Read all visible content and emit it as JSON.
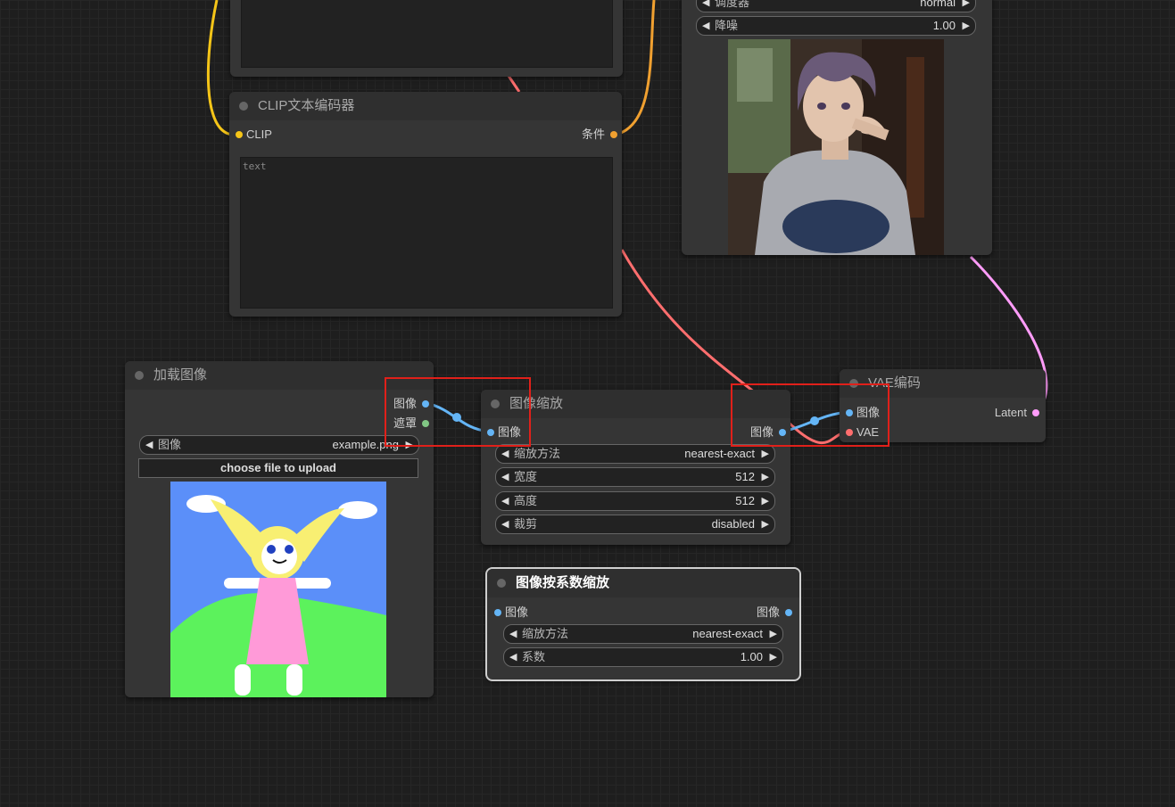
{
  "colors": {
    "canvas": "#1e1e1e",
    "node_bg": "#353535",
    "wire_clip": "#f5c518",
    "wire_conditioning": "#f0a030",
    "wire_image": "#64b5f6",
    "wire_vae": "#ff6e6e",
    "wire_latent": "#ff9cf9",
    "wire_mask": "#81c784",
    "highlight": "#e0201a"
  },
  "top_left_node": {},
  "clip_node": {
    "title": "CLIP文本编码器",
    "input_clip": "CLIP",
    "output_conditioning": "条件",
    "text_placeholder": "text"
  },
  "sampler_node": {
    "scheduler_label": "调度器",
    "scheduler_value": "normal",
    "denoise_label": "降噪",
    "denoise_value": "1.00",
    "preview_image": "anime-boy-preview-image"
  },
  "load_image_node": {
    "title": "加载图像",
    "output_image": "图像",
    "output_mask": "遮罩",
    "image_label": "图像",
    "image_value": "example.png",
    "upload_label": "choose file to upload",
    "preview_image": "child-drawing-preview-image"
  },
  "scale_node": {
    "title": "图像缩放",
    "input_image": "图像",
    "output_image": "图像",
    "widgets": [
      {
        "label": "缩放方法",
        "value": "nearest-exact"
      },
      {
        "label": "宽度",
        "value": "512"
      },
      {
        "label": "高度",
        "value": "512"
      },
      {
        "label": "裁剪",
        "value": "disabled"
      }
    ]
  },
  "scale_by_node": {
    "title": "图像按系数缩放",
    "input_image": "图像",
    "output_image": "图像",
    "widgets": [
      {
        "label": "缩放方法",
        "value": "nearest-exact"
      },
      {
        "label": "系数",
        "value": "1.00"
      }
    ]
  },
  "vae_encode_node": {
    "title": "VAE编码",
    "input_image": "图像",
    "input_vae": "VAE",
    "output_latent": "Latent"
  }
}
